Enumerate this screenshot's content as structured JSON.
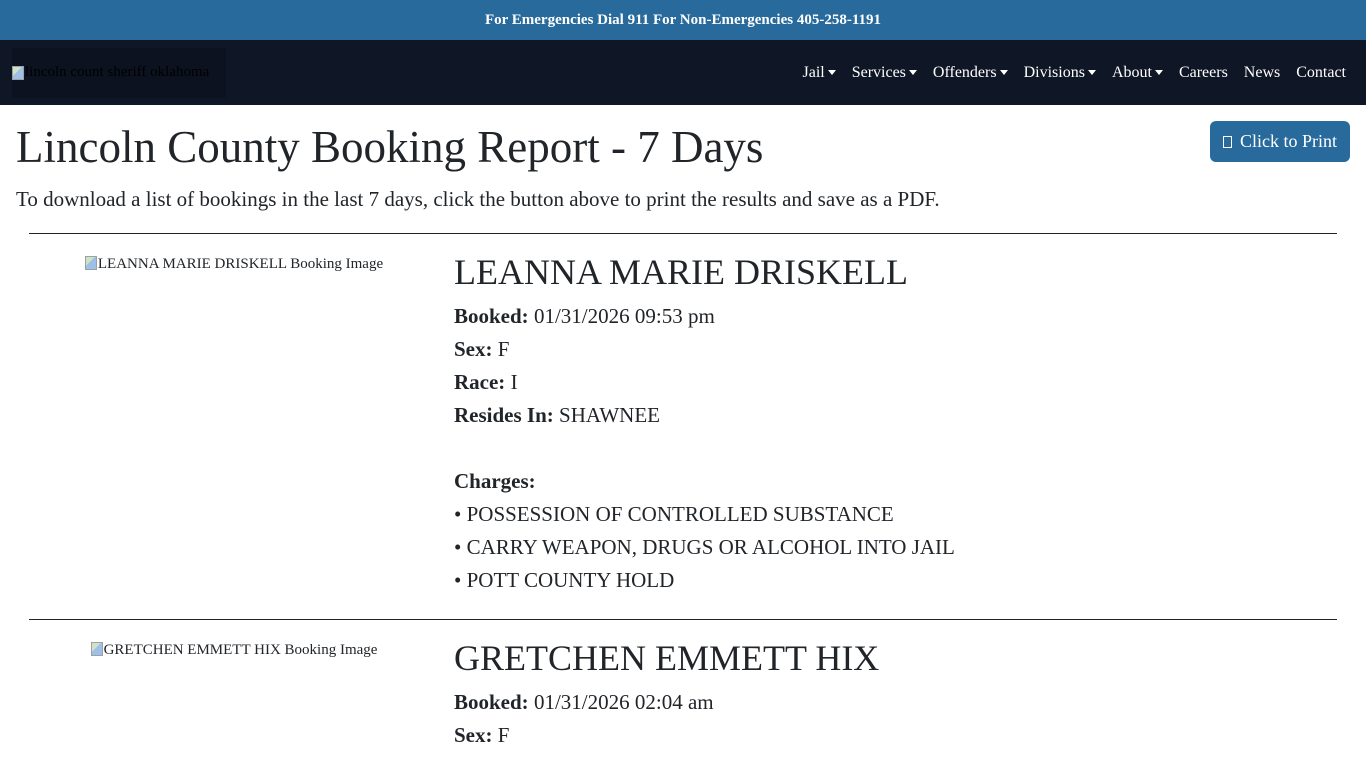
{
  "topbar": {
    "text": "For Emergencies Dial 911 For Non-Emergencies 405-258-1191"
  },
  "navbar": {
    "logo_alt": "lincoln count sheriff oklahoma",
    "items": [
      {
        "label": "Jail",
        "dropdown": true
      },
      {
        "label": "Services",
        "dropdown": true
      },
      {
        "label": "Offenders",
        "dropdown": true
      },
      {
        "label": "Divisions",
        "dropdown": true
      },
      {
        "label": "About",
        "dropdown": true
      },
      {
        "label": "Careers",
        "dropdown": false
      },
      {
        "label": "News",
        "dropdown": false
      },
      {
        "label": "Contact",
        "dropdown": false
      }
    ]
  },
  "page": {
    "title": "Lincoln County Booking Report - 7 Days",
    "print_button": "Click to Print",
    "intro": "To download a list of bookings in the last 7 days, click the button above to print the results and save as a PDF."
  },
  "labels": {
    "booked": "Booked:",
    "sex": "Sex:",
    "race": "Race:",
    "resides": "Resides In:",
    "charges": "Charges:"
  },
  "records": [
    {
      "image_alt": "LEANNA MARIE DRISKELL Booking Image",
      "name": "LEANNA MARIE DRISKELL",
      "booked": "01/31/2026 09:53 pm",
      "sex": "F",
      "race": "I",
      "resides": "SHAWNEE",
      "charges": [
        "• POSSESSION OF CONTROLLED SUBSTANCE",
        "• CARRY WEAPON, DRUGS OR ALCOHOL INTO JAIL",
        "• POTT COUNTY HOLD"
      ]
    },
    {
      "image_alt": "GRETCHEN EMMETT HIX Booking Image",
      "name": "GRETCHEN EMMETT HIX",
      "booked": "01/31/2026 02:04 am",
      "sex": "F"
    }
  ],
  "colors": {
    "topbar": "#276a9b",
    "navbar": "#0f1626",
    "button": "#276a9b"
  }
}
